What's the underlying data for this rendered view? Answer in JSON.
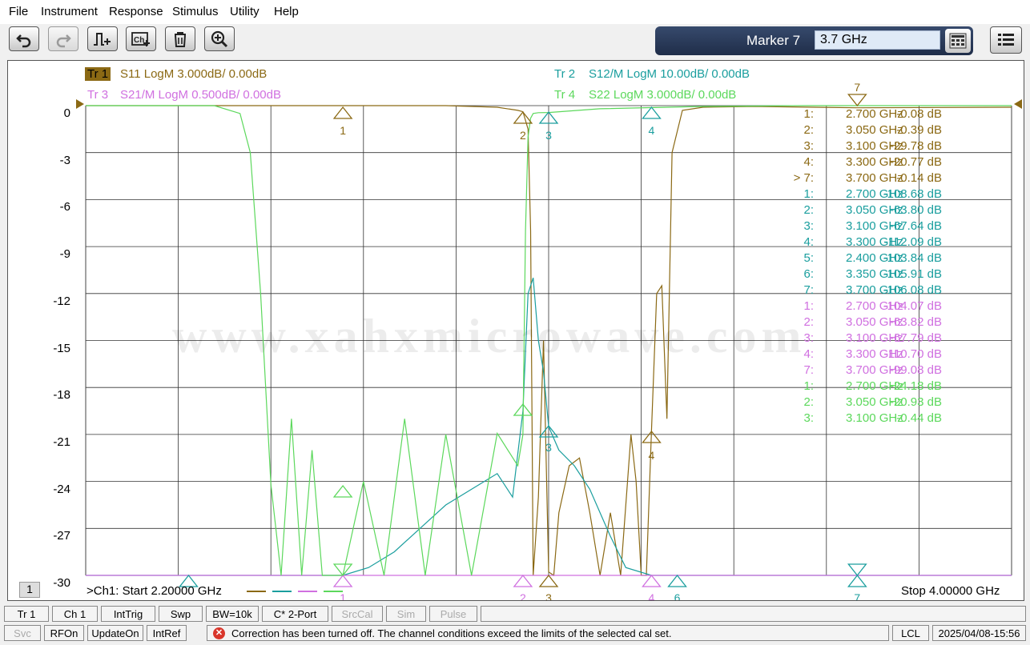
{
  "menu": [
    "File",
    "Instrument",
    "Response",
    "Stimulus",
    "Utility",
    "Help"
  ],
  "marker_panel": {
    "label": "Marker 7",
    "value": "3.7 GHz"
  },
  "traces": [
    {
      "tag": "Tr 1",
      "label": "S11 LogM 3.000dB/  0.00dB",
      "color": "#8b6914"
    },
    {
      "tag": "Tr 2",
      "label": "S12/M LogM 10.00dB/  0.00dB",
      "color": "#1a9e9e"
    },
    {
      "tag": "Tr 3",
      "label": "S21/M LogM 0.500dB/  0.00dB",
      "color": "#d070e0"
    },
    {
      "tag": "Tr 4",
      "label": "S22 LogM 3.000dB/  0.00dB",
      "color": "#5cd85c"
    }
  ],
  "yticks": [
    "0",
    "-3",
    "-6",
    "-9",
    "-12",
    "-15",
    "-18",
    "-21",
    "-24",
    "-27",
    "-30"
  ],
  "marker_table": [
    {
      "num": "1:",
      "freq": "2.700  GHz",
      "val": "-0.08 dB",
      "color": "#8b6914"
    },
    {
      "num": "2:",
      "freq": "3.050  GHz",
      "val": "-0.39 dB",
      "color": "#8b6914"
    },
    {
      "num": "3:",
      "freq": "3.100  GHz",
      "val": "-29.78 dB",
      "color": "#8b6914"
    },
    {
      "num": "4:",
      "freq": "3.300  GHz",
      "val": "-20.77 dB",
      "color": "#8b6914"
    },
    {
      "num": "> 7:",
      "freq": "3.700  GHz",
      "val": "-0.14 dB",
      "color": "#8b6914"
    },
    {
      "num": "1:",
      "freq": "2.700  GHz",
      "val": "-108.68 dB",
      "color": "#1a9e9e"
    },
    {
      "num": "2:",
      "freq": "3.050  GHz",
      "val": "-63.80 dB",
      "color": "#1a9e9e"
    },
    {
      "num": "3:",
      "freq": "3.100  GHz",
      "val": "-67.64 dB",
      "color": "#1a9e9e"
    },
    {
      "num": "4:",
      "freq": "3.300  GHz",
      "val": "-112.09 dB",
      "color": "#1a9e9e"
    },
    {
      "num": "5:",
      "freq": "2.400  GHz",
      "val": "-103.84 dB",
      "color": "#1a9e9e"
    },
    {
      "num": "6:",
      "freq": "3.350  GHz",
      "val": "-105.91 dB",
      "color": "#1a9e9e"
    },
    {
      "num": "7:",
      "freq": "3.700  GHz",
      "val": "-106.08 dB",
      "color": "#1a9e9e"
    },
    {
      "num": "1:",
      "freq": "2.700  GHz",
      "val": "-104.07 dB",
      "color": "#d070e0"
    },
    {
      "num": "2:",
      "freq": "3.050  GHz",
      "val": "-63.82 dB",
      "color": "#d070e0"
    },
    {
      "num": "3:",
      "freq": "3.100  GHz",
      "val": "-67.79 dB",
      "color": "#d070e0"
    },
    {
      "num": "4:",
      "freq": "3.300  GHz",
      "val": "-110.70 dB",
      "color": "#d070e0"
    },
    {
      "num": "7:",
      "freq": "3.700  GHz",
      "val": "-99.08 dB",
      "color": "#d070e0"
    },
    {
      "num": "1:",
      "freq": "2.700  GHz",
      "val": "-24.18 dB",
      "color": "#5cd85c"
    },
    {
      "num": "2:",
      "freq": "3.050  GHz",
      "val": "-20.93 dB",
      "color": "#5cd85c"
    },
    {
      "num": "3:",
      "freq": "3.100  GHz",
      "val": "-0.44 dB",
      "color": "#5cd85c"
    }
  ],
  "watermark": "www.xahxmicrowave.com",
  "channel_number": "1",
  "footer": {
    "start": ">Ch1:  Start  2.20000 GHz",
    "stop": "Stop  4.00000 GHz"
  },
  "markers_on_plot": {
    "top": "7",
    "s11": [
      "1",
      "2",
      "3",
      "4"
    ],
    "bottom": [
      "1",
      "2",
      "3",
      "4",
      "6",
      "7"
    ]
  },
  "status_row1": [
    "Tr 1",
    "Ch 1",
    "IntTrig",
    "Swp",
    "BW=10k",
    "C* 2-Port",
    "SrcCal",
    "Sim",
    "Pulse"
  ],
  "status_row2": [
    "Svc",
    "RFOn",
    "UpdateOn",
    "IntRef"
  ],
  "error_message": "Correction has been turned off. The channel conditions exceed the limits of the selected cal set.",
  "lcl": "LCL",
  "datetime": "2025/04/08-15:56",
  "chart_data": {
    "type": "line",
    "xlim": [
      2.2,
      4.0
    ],
    "ylim": [
      -30,
      0
    ],
    "x_unit": "GHz",
    "y_unit": "dB",
    "grid": true,
    "series": [
      {
        "name": "S11",
        "color": "#8b6914",
        "x": [
          2.2,
          2.5,
          2.9,
          3.0,
          3.04,
          3.05,
          3.06,
          3.065,
          3.07,
          3.08,
          3.09,
          3.1,
          3.11,
          3.12,
          3.14,
          3.16,
          3.18,
          3.2,
          3.22,
          3.24,
          3.26,
          3.27,
          3.28,
          3.29,
          3.3,
          3.31,
          3.32,
          3.33,
          3.34,
          3.36,
          3.4,
          3.5,
          3.7,
          4.0
        ],
        "y": [
          0,
          0,
          0,
          -0.1,
          -0.3,
          -0.39,
          -1.5,
          -8,
          -30,
          -25,
          -15,
          -29.78,
          -30,
          -26,
          -23,
          -22.5,
          -26,
          -30,
          -26,
          -30,
          -21,
          -24,
          -30,
          -30,
          -20.77,
          -12,
          -11.5,
          -20,
          -3,
          -0.3,
          -0.1,
          -0.05,
          -0.14,
          -0.1
        ]
      },
      {
        "name": "S12",
        "color": "#1a9e9e",
        "x": [
          2.2,
          2.6,
          2.7,
          2.75,
          2.8,
          2.85,
          2.9,
          2.95,
          3.0,
          3.03,
          3.05,
          3.06,
          3.07,
          3.08,
          3.09,
          3.1,
          3.12,
          3.15,
          3.18,
          3.2,
          3.22,
          3.25,
          3.3,
          3.35,
          3.4,
          4.0
        ],
        "y": [
          -30,
          -30,
          -30,
          -29.5,
          -28.5,
          -27,
          -25.5,
          -24.5,
          -23.5,
          -25,
          -19.5,
          -12,
          -11,
          -15,
          -17,
          -20.5,
          -22,
          -23,
          -24.5,
          -26,
          -27.5,
          -29.5,
          -30,
          -30,
          -30,
          -30
        ]
      },
      {
        "name": "S21",
        "color": "#d070e0",
        "x": [
          2.2,
          4.0
        ],
        "y": [
          -30,
          -30
        ]
      },
      {
        "name": "S22",
        "color": "#5cd85c",
        "x": [
          2.2,
          2.45,
          2.5,
          2.52,
          2.54,
          2.56,
          2.58,
          2.6,
          2.62,
          2.64,
          2.66,
          2.7,
          2.74,
          2.78,
          2.82,
          2.86,
          2.9,
          2.95,
          3.0,
          3.04,
          3.05,
          3.055,
          3.06,
          3.065,
          3.07,
          3.08,
          3.1,
          3.2,
          3.4,
          3.6,
          4.0
        ],
        "y": [
          0,
          0,
          -0.5,
          -3,
          -12,
          -24.18,
          -30,
          -20,
          -30,
          -22,
          -30,
          -30,
          -24,
          -30,
          -20,
          -30,
          -21,
          -30,
          -20.93,
          -23,
          -21,
          -8,
          -2,
          -0.8,
          -0.5,
          -0.45,
          -0.44,
          -0.2,
          -0.05,
          0,
          0
        ]
      }
    ]
  }
}
